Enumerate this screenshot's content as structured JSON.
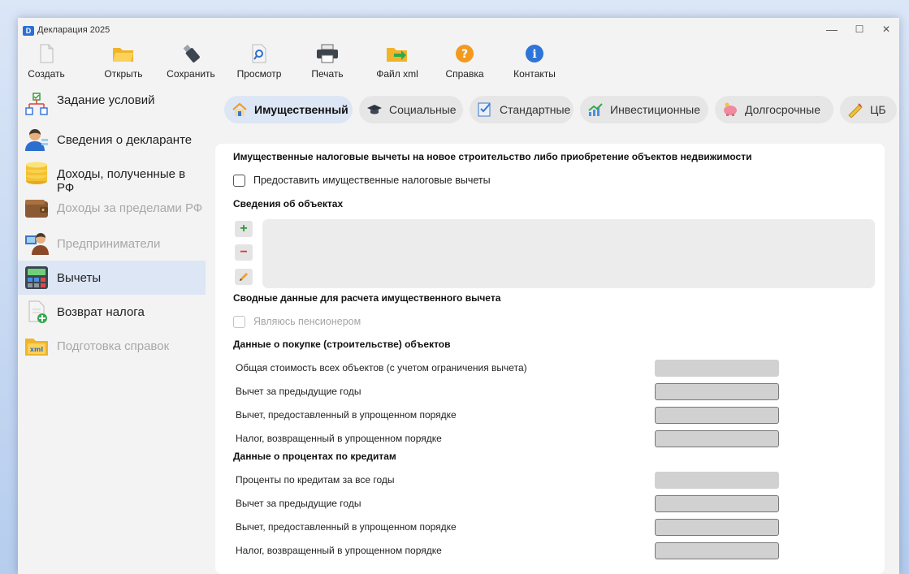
{
  "window": {
    "title": "Декларация 2025",
    "minimize": "—",
    "maximize": "☐",
    "close": "✕"
  },
  "toolbar": [
    {
      "label": "Создать",
      "icon": "new-document-icon"
    },
    {
      "label": "Открыть",
      "icon": "open-folder-icon"
    },
    {
      "label": "Сохранить",
      "icon": "save-usb-icon"
    },
    {
      "label": "Просмотр",
      "icon": "preview-magnifier-icon"
    },
    {
      "label": "Печать",
      "icon": "printer-icon"
    },
    {
      "label": "Файл xml",
      "icon": "xml-file-export-icon"
    },
    {
      "label": "Справка",
      "icon": "help-icon"
    },
    {
      "label": "Контакты",
      "icon": "info-icon"
    }
  ],
  "sidebar": [
    {
      "label": "Задание условий",
      "icon": "conditions-flow-icon",
      "state": "normal"
    },
    {
      "label": "Сведения о декларанте",
      "icon": "person-icon",
      "state": "normal"
    },
    {
      "label": "Доходы, полученные в РФ",
      "icon": "coins-icon",
      "state": "normal"
    },
    {
      "label": "Доходы за пределами РФ",
      "icon": "wallet-icon",
      "state": "disabled"
    },
    {
      "label": "Предприниматели",
      "icon": "businessman-icon",
      "state": "disabled"
    },
    {
      "label": "Вычеты",
      "icon": "calculator-icon",
      "state": "active"
    },
    {
      "label": "Возврат налога",
      "icon": "document-plus-icon",
      "state": "normal"
    },
    {
      "label": "Подготовка справок",
      "icon": "xml-folder-icon",
      "state": "disabled"
    }
  ],
  "tabs": [
    {
      "label": "Имущественный",
      "icon": "house-icon",
      "active": true
    },
    {
      "label": "Социальные",
      "icon": "graduation-cap-icon",
      "active": false
    },
    {
      "label": "Стандартные",
      "icon": "checklist-icon",
      "active": false
    },
    {
      "label": "Инвестиционные",
      "icon": "growth-chart-icon",
      "active": false
    },
    {
      "label": "Долгосрочные",
      "icon": "piggy-bank-icon",
      "active": false
    },
    {
      "label": "ЦБ",
      "icon": "securities-icon",
      "active": false
    }
  ],
  "panel": {
    "header": "Имущественные налоговые вычеты на новое строительство либо приобретение объектов недвижимости",
    "provide_checkbox": "Предоставить имущественные налоговые вычеты",
    "objects_heading": "Сведения об объектах",
    "add_symbol": "+",
    "remove_symbol": "−",
    "summary_heading": "Сводные данные для расчета имущественного вычета",
    "pensioner_checkbox": "Являюсь пенсионером",
    "purchase_heading": "Данные о покупке (строительстве) объектов",
    "purchase_rows": [
      "Общая стоимость всех объектов (с учетом ограничения вычета)",
      "Вычет за предыдущие годы",
      "Вычет, предоставленный в упрощенном порядке",
      "Налог, возвращенный в упрощенном порядке"
    ],
    "credit_heading": "Данные о процентах по кредитам",
    "credit_rows": [
      "Проценты по кредитам за все годы",
      "Вычет за предыдущие годы",
      "Вычет, предоставленный в упрощенном порядке",
      "Налог, возвращенный в упрощенном порядке"
    ]
  },
  "colors": {
    "active_bg": "#dde6f4",
    "disabled_text": "#a8a8a8",
    "field_bg": "#d1d1d1",
    "add_green": "#2e9a2e",
    "remove_red": "#e0303a"
  }
}
